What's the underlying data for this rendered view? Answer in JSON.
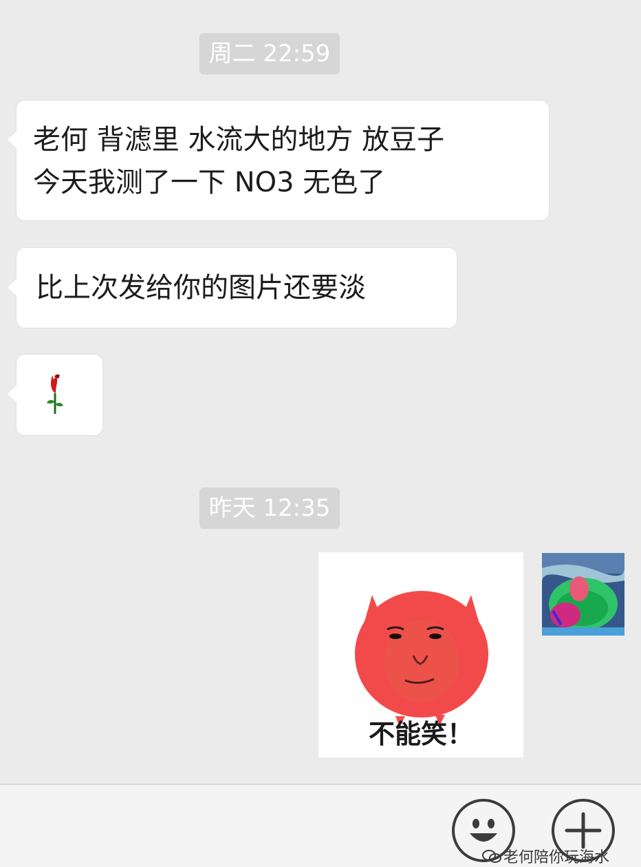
{
  "messages": {
    "timestamp_1": "周二 22:59",
    "bubble_1_line_1": "老何 背滤里 水流大的地方 放豆子",
    "bubble_1_line_2": "今天我测了一下 NO3 无色了",
    "bubble_2": "比上次发给你的图片还要淡",
    "bubble_3_icon": "rose-icon",
    "timestamp_2": "昨天 12:35",
    "sticker_caption": "不能笑！"
  },
  "avatar": {
    "icon": "coral-avatar"
  },
  "input_bar": {
    "emoji_icon": "smiley-icon",
    "plus_icon": "plus-icon"
  },
  "watermark": {
    "text": "老何陪你玩海水",
    "icon": "wechat-icon"
  },
  "colors": {
    "background": "#ebebeb",
    "bubble": "#ffffff",
    "timestamp_bg": "#d6d6d6",
    "sticker_face": "#f24a4a"
  }
}
